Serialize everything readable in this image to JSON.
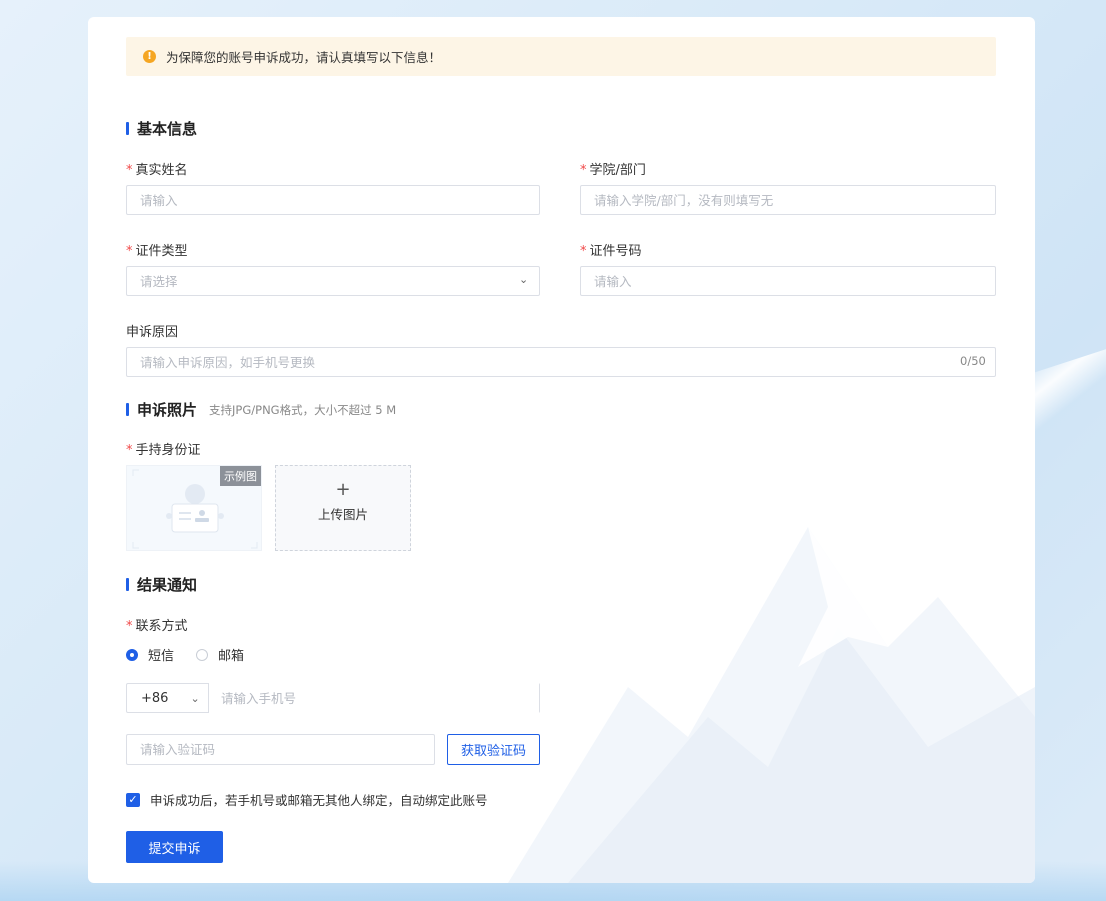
{
  "notice": {
    "text": "为保障您的账号申诉成功，请认真填写以下信息！"
  },
  "sections": {
    "basic": {
      "title": "基本信息"
    },
    "photo": {
      "title": "申诉照片",
      "hint": "支持JPG/PNG格式，大小不超过 5 M"
    },
    "result": {
      "title": "结果通知"
    }
  },
  "fields": {
    "real_name": {
      "label": "真实姓名",
      "placeholder": "请输入",
      "required": true
    },
    "department": {
      "label": "学院/部门",
      "placeholder": "请输入学院/部门，没有则填写无",
      "required": true
    },
    "id_type": {
      "label": "证件类型",
      "placeholder": "请选择",
      "required": true
    },
    "id_number": {
      "label": "证件号码",
      "placeholder": "请输入",
      "required": true
    },
    "reason": {
      "label": "申诉原因",
      "placeholder": "请输入申诉原因，如手机号更换",
      "counter": "0/50",
      "required": false
    },
    "id_photo": {
      "label": "手持身份证",
      "sample_tag": "示例图",
      "upload_plus": "+",
      "upload_label": "上传图片",
      "required": true
    },
    "contact": {
      "label": "联系方式",
      "required": true,
      "options": [
        "短信",
        "邮箱"
      ],
      "selected": "短信"
    },
    "phone": {
      "country_code": "+86",
      "placeholder": "请输入手机号"
    },
    "code": {
      "placeholder": "请输入验证码",
      "button": "获取验证码"
    }
  },
  "agreement": {
    "checked": true,
    "text": "申诉成功后，若手机号或邮箱无其他人绑定，自动绑定此账号"
  },
  "submit": {
    "label": "提交申诉"
  },
  "colors": {
    "primary": "#1f5fe6",
    "warning": "#f5a623",
    "notice_bg": "#fdf5e6",
    "required": "#f04848"
  }
}
